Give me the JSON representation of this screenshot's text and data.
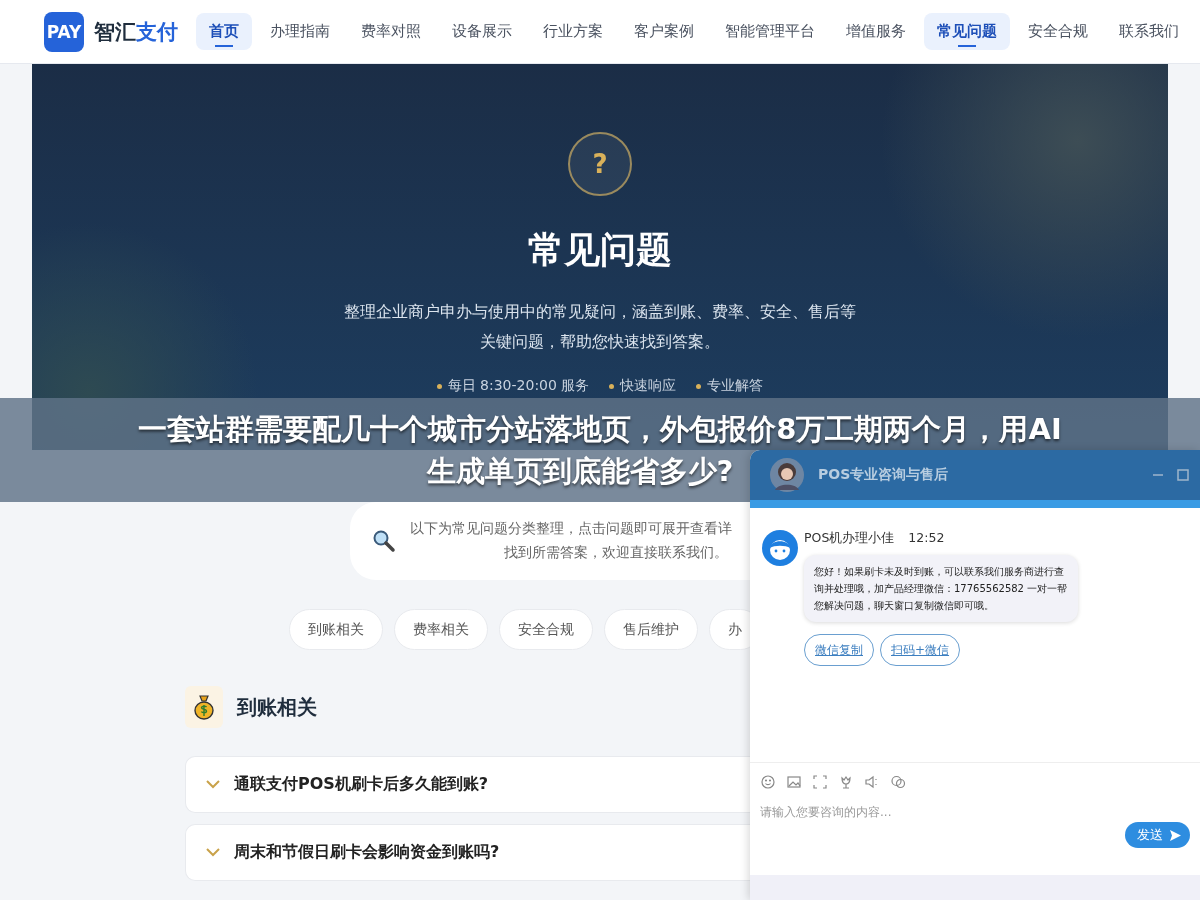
{
  "logo": {
    "badge": "PAY",
    "name_dark": "智汇",
    "name_blue": "支付"
  },
  "nav": [
    {
      "label": "首页",
      "selected": true
    },
    {
      "label": "办理指南",
      "selected": false
    },
    {
      "label": "费率对照",
      "selected": false
    },
    {
      "label": "设备展示",
      "selected": false
    },
    {
      "label": "行业方案",
      "selected": false
    },
    {
      "label": "客户案例",
      "selected": false
    },
    {
      "label": "智能管理平台",
      "selected": false
    },
    {
      "label": "增值服务",
      "selected": false
    },
    {
      "label": "常见问题",
      "selected": true
    },
    {
      "label": "安全合规",
      "selected": false
    },
    {
      "label": "联系我们",
      "selected": false
    }
  ],
  "hero": {
    "icon": "?",
    "title": "常见问题",
    "description": "整理企业商户申办与使用中的常见疑问，涵盖到账、费率、安全、售后等关键问题，帮助您快速找到答案。",
    "features": [
      "每日 8:30-20:00 服务",
      "快速响应",
      "专业解答"
    ]
  },
  "hint": {
    "lines": [
      "以下为常见问题分类整理，点击问题即可展开查看详",
      "找到所需答案，欢迎直接联系我们。"
    ]
  },
  "categories": [
    {
      "label": "到账相关"
    },
    {
      "label": "费率相关"
    },
    {
      "label": "安全合规"
    },
    {
      "label": "售后维护"
    },
    {
      "label": "办"
    }
  ],
  "section": {
    "title": "到账相关",
    "questions": [
      {
        "text": "通联支付POS机刷卡后多久能到账?",
        "expanded": false
      },
      {
        "text": "周末和节假日刷卡会影响资金到账吗?",
        "expanded": false
      }
    ]
  },
  "banner": {
    "lines": [
      "一套站群需要配几十个城市分站落地页，外包报价8万工期两个月，用AI",
      "生成单页到底能省多少?"
    ]
  },
  "chat": {
    "title": "POS专业咨询与售后",
    "agent": "POS机办理小佳",
    "time": "12:52",
    "message": "您好！如果刷卡未及时到账，可以联系我们服务商进行查询并处理哦，加产品经理微信：17765562582 一对一帮您解决问题，聊天窗口复制微信即可哦。",
    "actions": [
      "微信复制",
      "扫码+微信"
    ],
    "placeholder": "请输入您要咨询的内容...",
    "send": "发送"
  }
}
